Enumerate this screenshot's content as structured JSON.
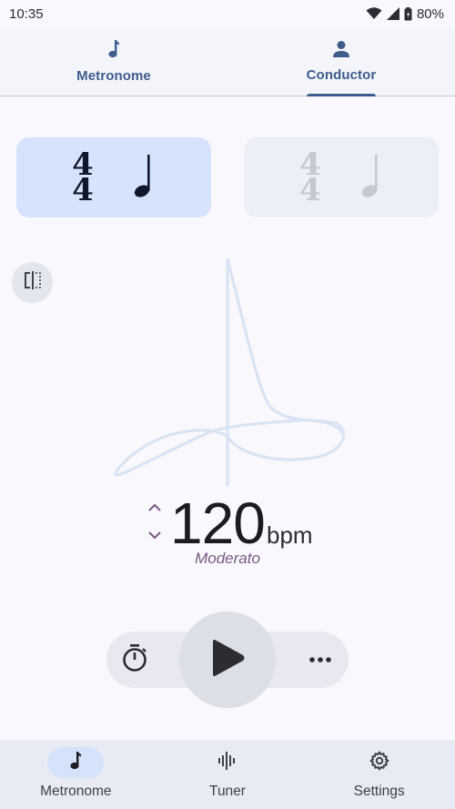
{
  "status_bar": {
    "time": "10:35",
    "battery": "80%",
    "icons": [
      "wifi-icon",
      "signal-icon",
      "battery-icon"
    ]
  },
  "top_tabs": [
    {
      "label": "Metronome",
      "icon": "music-note-icon",
      "active": false
    },
    {
      "label": "Conductor",
      "icon": "person-icon",
      "active": true
    }
  ],
  "time_signatures": [
    {
      "numerator": "4",
      "denominator": "4",
      "note": "quarter-note-icon",
      "selected": true
    },
    {
      "numerator": "4",
      "denominator": "4",
      "note": "quarter-note-icon",
      "selected": false
    }
  ],
  "tempo": {
    "value": "120",
    "unit": "bpm",
    "name": "Moderato"
  },
  "player": {
    "timer_icon": "timer-icon",
    "play_icon": "play-icon",
    "more_icon": "more-horizontal-icon"
  },
  "bottom_nav": [
    {
      "label": "Metronome",
      "icon": "music-note-icon",
      "active": true
    },
    {
      "label": "Tuner",
      "icon": "waveform-icon",
      "active": false
    },
    {
      "label": "Settings",
      "icon": "gear-icon",
      "active": false
    }
  ],
  "colors": {
    "accent": "#3d5c8c",
    "selected_card": "#d6e3fc",
    "tempo_name": "#7a5a80",
    "conductor_path": "#d8e3f3"
  }
}
